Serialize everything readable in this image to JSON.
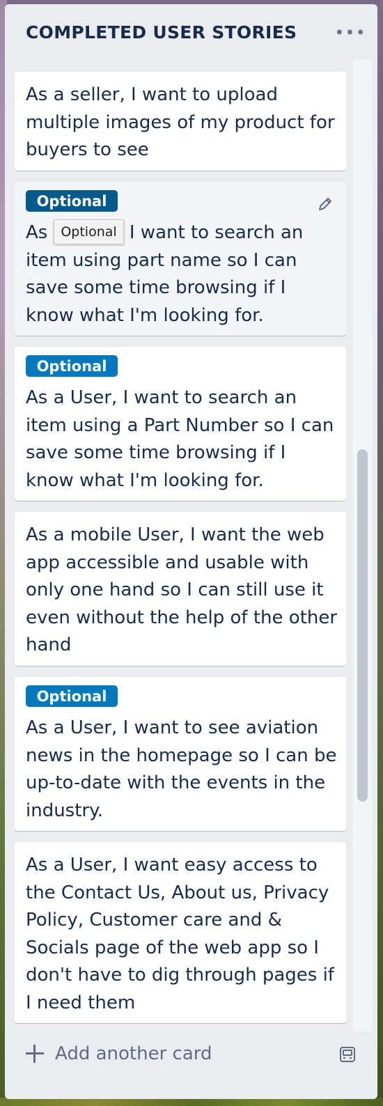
{
  "list": {
    "title": "COMPLETED USER STORIES",
    "menu_glyph": "•••",
    "menu_icon": "ellipsis-icon"
  },
  "cards": [
    {
      "text": "As a seller, I want to upload multiple images of my product for buyers to see"
    },
    {
      "label": "Optional",
      "label_color": "#055a8c",
      "text_before": "As ",
      "text_after": " I want to search an item using part name so I can save some time browsing if I know what I'm looking for.",
      "tooltip": "Optional",
      "edit_icon": "pencil-icon"
    },
    {
      "label": "Optional",
      "label_color": "#0079bf",
      "text": "As a User, I want to search an item using a Part Number so I can save some time browsing if I know what I'm looking for."
    },
    {
      "text": "As a mobile User, I want the web app accessible and usable with only one hand so I can still use it even without the help of the other hand"
    },
    {
      "label": "Optional",
      "label_color": "#0079bf",
      "text": "As a User, I want to see aviation news in the homepage so I can be up-to-date with the events in the industry."
    },
    {
      "text": "As a User, I want easy access to the Contact Us, About us, Privacy Policy, Customer care and & Socials page of the web app so I don't have to dig through pages if I need them"
    }
  ],
  "footer": {
    "add_card_label": "Add another card",
    "add_icon": "plus-icon",
    "template_icon": "card-template-icon"
  },
  "colors": {
    "list_bg": "#ebecf0",
    "card_bg": "#ffffff",
    "text": "#172b4d",
    "label_blue": "#0079bf",
    "label_blue_hover": "#055a8c",
    "muted": "#5e6c84"
  }
}
